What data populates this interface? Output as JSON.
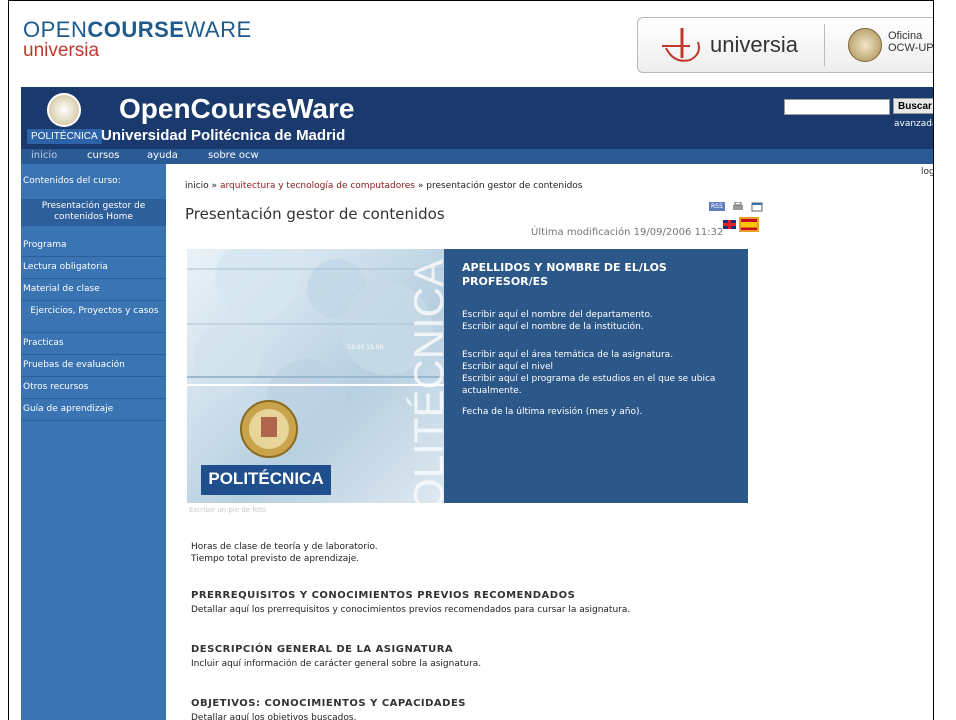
{
  "banner": {
    "ocw_open": "OPEN",
    "ocw_course": "COURSE",
    "ocw_ware": "WARE",
    "ocw_universia": "universia",
    "universia_label": "universia",
    "oficina_line1": "Oficina",
    "oficina_line2": "OCW-UPM"
  },
  "header": {
    "title": "OpenCourseWare",
    "badge": "POLITÉCNICA",
    "subtitle": "Universidad Politécnica de Madrid",
    "search_button": "Buscar",
    "advanced_link": "avanzada"
  },
  "nav": {
    "items": [
      "inicio",
      "cursos",
      "ayuda",
      "sobre ocw"
    ]
  },
  "sidebar": {
    "title": "Contenidos del curso:",
    "items": [
      "Presentación gestor de contenidos Home",
      "Programa",
      "Lectura obligatoria",
      "Material de clase",
      "Ejercicios, Proyectos y casos",
      "Practicas",
      "Pruebas de evaluación",
      "Otros recursos",
      "Guía de aprendizaje"
    ]
  },
  "main": {
    "login": "logi",
    "breadcrumb": {
      "home": "inicio",
      "sep": "»",
      "category": "arquitectura y tecnología de computadores",
      "current": "presentación gestor de contenidos"
    },
    "title": "Presentación gestor de contenidos",
    "rss_label": "RSS",
    "modified": "Última modificación 19/09/2006 11:32",
    "image_brand": "POLITÉCNICA",
    "image_vertical": "POLITÉCNICA",
    "caption": "Escribir un pie de foto",
    "hero": {
      "heading": "APELLIDOS Y NOMBRE DE EL/LOS PROFESOR/ES",
      "p1": "Escribir aquí el nombre del departamento.",
      "p2": "Escribir aquí el nombre de la institución.",
      "p3": "Escribir aquí el área temática de la asignatura.",
      "p4": "Escribir aquí el nivel",
      "p5": "Escribir aquí el programa de estudios en el que se ubica actualmente.",
      "p6": "Fecha de la última revisión (mes y año)."
    },
    "hours_line1": "Horas de clase de teoría y de laboratorio.",
    "hours_line2": "Tiempo total previsto de aprendizaje.",
    "sections": [
      {
        "heading": "PRERREQUISITOS Y CONOCIMIENTOS PREVIOS RECOMENDADOS",
        "text": "Detallar aquí los prerrequisitos y conocimientos previos recomendados para cursar la asignatura."
      },
      {
        "heading": "DESCRIPCIÓN GENERAL DE LA ASIGNATURA",
        "text": "Incluir aquí información de carácter general sobre la asignatura."
      },
      {
        "heading": "OBJETIVOS: CONOCIMIENTOS Y CAPACIDADES",
        "text": "Detallar aquí los objetivos buscados."
      }
    ]
  },
  "colors": {
    "header_bg": "#1a3a6e",
    "nav_bg": "#2c5a94",
    "sidebar_bg": "#3a74b3",
    "hero_box_bg": "#2c5789",
    "breadcrumb_link": "#8a1a1a"
  }
}
